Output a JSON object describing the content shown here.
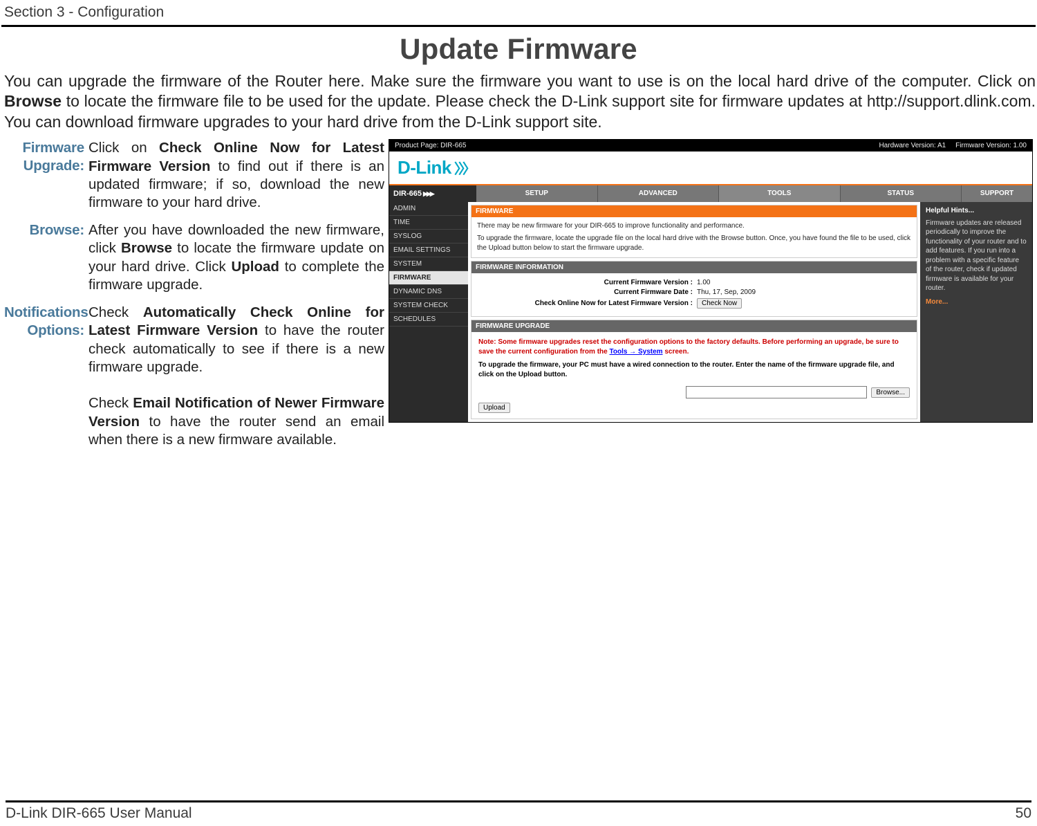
{
  "section_header": "Section 3 - Configuration",
  "page_title": "Update Firmware",
  "intro": {
    "p1a": "You can upgrade the firmware of the Router here. Make sure the firmware you want to use is on the local hard drive of the computer. Click on ",
    "p1b_bold": "Browse",
    "p1c": " to locate the firmware file to be used for the update. Please check the D-Link support site for firmware updates at http://support.dlink.com. You can download firmware upgrades to your hard drive from the D-Link support site."
  },
  "defs": {
    "firmware_upgrade": {
      "term": "Firmware Upgrade:",
      "t1": "Click on ",
      "b1": "Check Online Now for Latest Firmware Version",
      "t2": " to find out if there is an updated firmware; if so, download the new firmware to your hard drive."
    },
    "browse": {
      "term": "Browse:",
      "t1": "After you have downloaded the new firmware, click ",
      "b1": "Browse",
      "t2": " to locate the firmware update on your hard drive.  Click ",
      "b2": "Upload",
      "t3": " to complete the firmware upgrade."
    },
    "notifications": {
      "term": "Notifications Options:",
      "t1": "Check ",
      "b1": "Automatically Check Online for Latest Firmware Version",
      "t2": " to have the router check automatically to see if there is a new firmware upgrade.",
      "t3": "Check ",
      "b3": "Email Notification of Newer Firmware Version",
      "t4": " to have the router send an email when there is a new firmware available."
    }
  },
  "router": {
    "topbar": {
      "product": "Product Page: DIR-665",
      "hw": "Hardware Version: A1",
      "fw": "Firmware Version: 1.00"
    },
    "logo": "D-Link",
    "nav": {
      "model": "DIR-665",
      "tabs": [
        "SETUP",
        "ADVANCED",
        "TOOLS",
        "STATUS"
      ],
      "support": "SUPPORT"
    },
    "side": [
      "ADMIN",
      "TIME",
      "SYSLOG",
      "EMAIL SETTINGS",
      "SYSTEM",
      "FIRMWARE",
      "DYNAMIC DNS",
      "SYSTEM CHECK",
      "SCHEDULES"
    ],
    "mainpanel": {
      "head": "FIRMWARE",
      "line1": "There may be new firmware for your DIR-665 to improve functionality and performance.",
      "line2": "To upgrade the firmware, locate the upgrade file on the local hard drive with the Browse button. Once, you have found the file to be used, click the Upload button below to start the firmware upgrade."
    },
    "info": {
      "head": "FIRMWARE INFORMATION",
      "rows": {
        "ver_label": "Current Firmware Version :",
        "ver_value": "1.00",
        "date_label": "Current Firmware Date :",
        "date_value": "Thu, 17, Sep, 2009",
        "check_label": "Check Online Now for Latest Firmware Version :",
        "check_btn": "Check Now"
      }
    },
    "upgrade": {
      "head": "FIRMWARE UPGRADE",
      "warn1": "Note: Some firmware upgrades reset the configuration options to the factory defaults. Before performing an upgrade, be sure to save the current configuration from the ",
      "warn_link": "Tools → System",
      "warn2": " screen.",
      "note": "To upgrade the firmware, your PC must have a wired connection to the router. Enter the name of the firmware upgrade file, and click on the Upload button.",
      "browse_btn": "Browse...",
      "upload_btn": "Upload"
    },
    "hints": {
      "head": "Helpful Hints...",
      "body": "Firmware updates are released periodically to improve the functionality of your router and to add features. If you run into a problem with a specific feature of the router, check if updated firmware is available for your router.",
      "more": "More..."
    }
  },
  "footer": {
    "left": "D-Link DIR-665 User Manual",
    "right": "50"
  }
}
